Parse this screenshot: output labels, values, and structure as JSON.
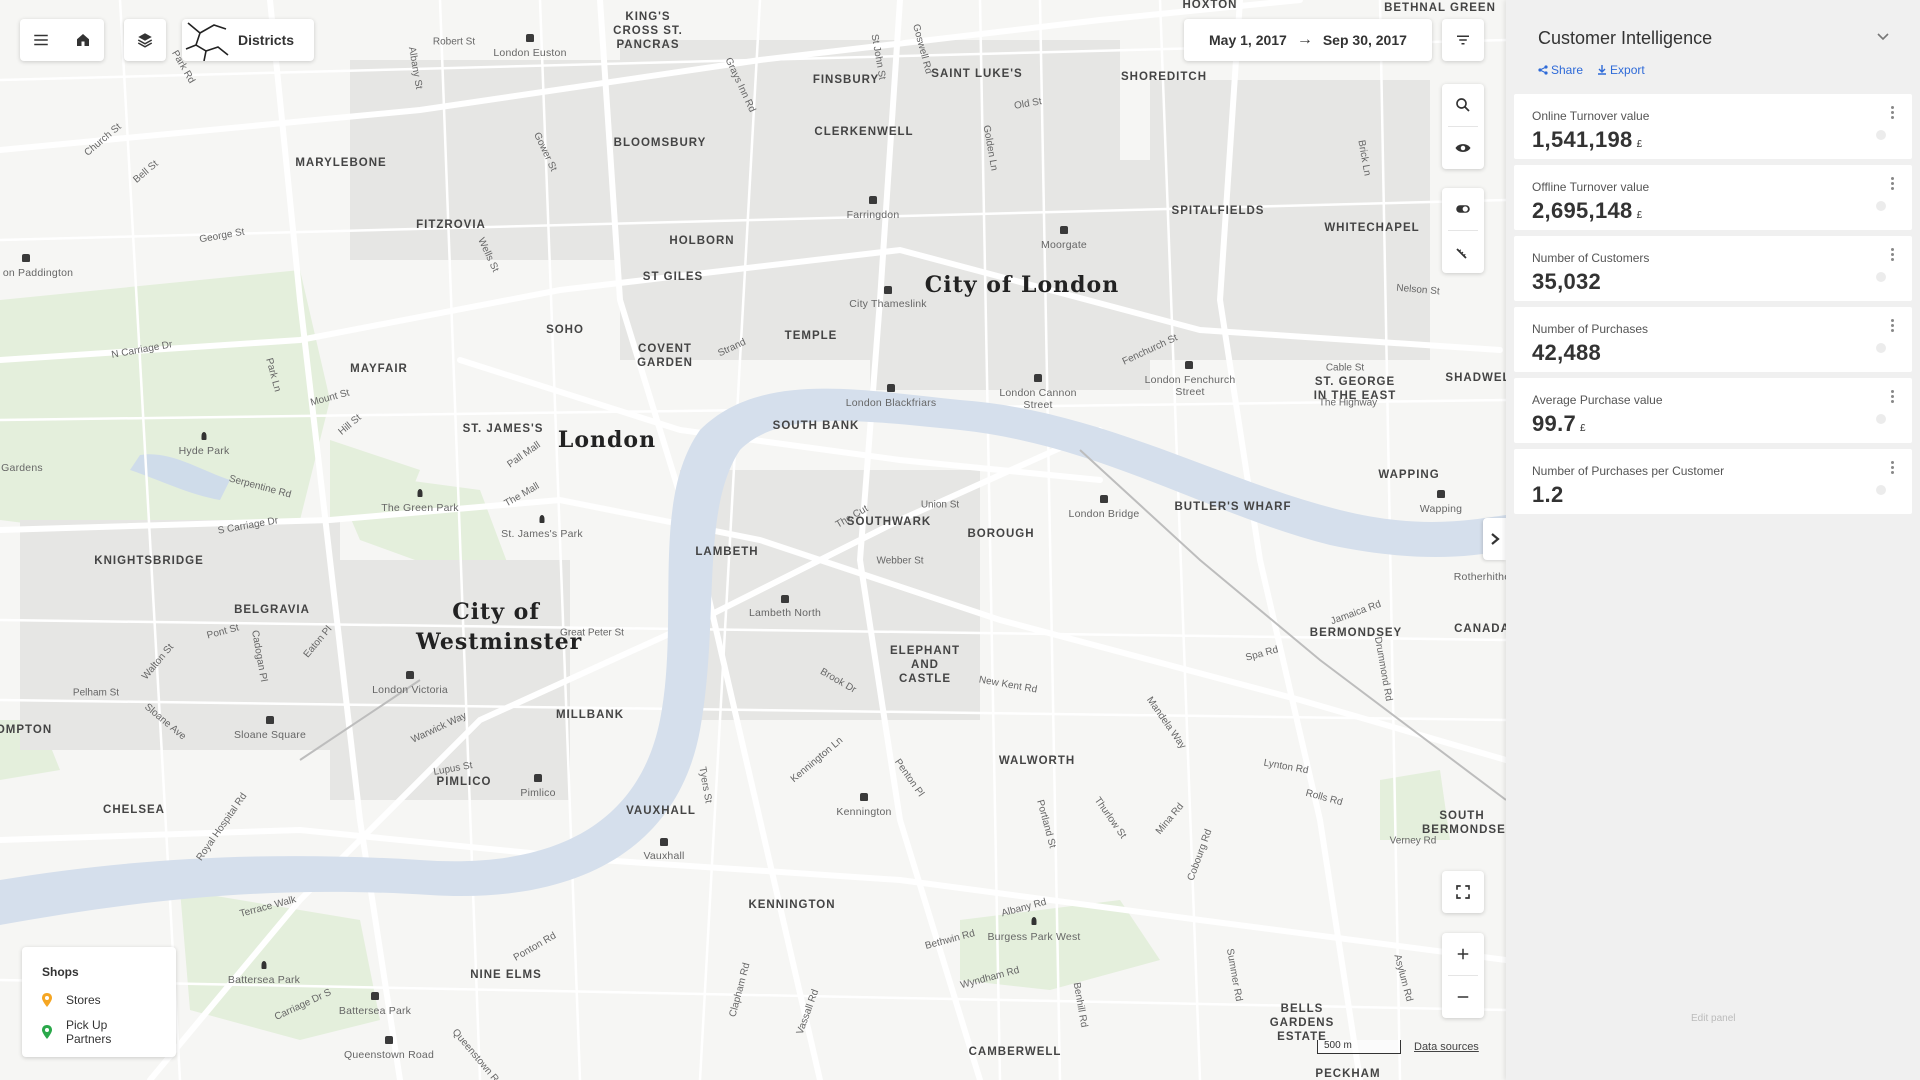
{
  "toolbar": {
    "menu_icon": "menu-icon",
    "home_icon": "home-icon",
    "layers_icon": "layers-icon",
    "layer_name": "Districts"
  },
  "date_range": {
    "start": "May 1, 2017",
    "arrow": "→",
    "end": "Sep 30, 2017"
  },
  "map": {
    "big_labels": [
      {
        "id": "city-of-london",
        "text": "City of London"
      },
      {
        "id": "london",
        "text": "London"
      },
      {
        "id": "westminster",
        "text": "City of Westminster"
      }
    ],
    "districts": [
      "KING'S CROSS ST. PANCRAS",
      "FINSBURY",
      "SAINT LUKE'S",
      "SHOREDITCH",
      "HOXTON",
      "BETHNAL GREEN",
      "MARYLEBONE",
      "BLOOMSBURY",
      "CLERKENWELL",
      "SPITALFIELDS",
      "WHITECHAPEL",
      "FITZROVIA",
      "HOLBORN",
      "ST GILES",
      "SOHO",
      "COVENT GARDEN",
      "TEMPLE",
      "MAYFAIR",
      "ST. JAMES'S",
      "SOUTH BANK",
      "ST. GEORGE IN THE EAST",
      "SHADWELL",
      "WAPPING",
      "BUTLER'S WHARF",
      "SOUTHWARK",
      "BOROUGH",
      "LAMBETH",
      "KNIGHTSBRIDGE",
      "BELGRAVIA",
      "ELEPHANT AND CASTLE",
      "BERMONDSEY",
      "CANADA",
      "MILLBANK",
      "PIMLICO",
      "WALWORTH",
      "VAUXHALL",
      "CHELSEA",
      "KENNINGTON",
      "NINE ELMS",
      "SOUTH BERMONDSEY",
      "BELLS GARDENS ESTATE",
      "CAMBERWELL",
      "PECKHAM",
      "OMPTON"
    ],
    "pois": [
      "London Euston",
      "Farringdon",
      "Moorgate",
      "City Thameslink",
      "London Blackfriars",
      "London Cannon Street",
      "London Fenchurch Street",
      "London Bridge",
      "Wapping",
      "Hyde Park",
      "The Green Park",
      "St. James's Park",
      "London Victoria",
      "Sloane Square",
      "Pimlico",
      "Vauxhall",
      "Kennington",
      "Lambeth North",
      "Burgess Park West",
      "Battersea Park",
      "Queenstown Road",
      "Rotherhithe",
      "on Paddington",
      "Gardens"
    ],
    "streets": [
      "Robert St",
      "Albany St",
      "Park Rd",
      "Church St",
      "Bell St",
      "George St",
      "N Carriage Dr",
      "Serpentine Rd",
      "S Carriage Dr",
      "Pall Mall",
      "The Mall",
      "Great Peter St",
      "Strand",
      "Fenchurch St",
      "Cable St",
      "The Highway",
      "Union St",
      "Webber St",
      "New Kent Rd",
      "Old St",
      "Golden Ln",
      "St John St",
      "Goswell Rd",
      "Grays Inn Rd",
      "Gower St",
      "Wells St",
      "Park Ln",
      "Mount St",
      "Hill St",
      "Brick Ln",
      "Nelson St",
      "Jamaica Rd",
      "Spa Rd",
      "Lynton Rd",
      "Rolls Rd",
      "Verney Rd",
      "Albany Rd",
      "Wyndham Rd",
      "Pont St",
      "Eaton Pl",
      "Cadogan Pl",
      "Walton St",
      "Pelham St",
      "Sloane Ave",
      "Lupus St",
      "Warwick Way",
      "Tyers St",
      "Kennington Ln",
      "Penton Pl",
      "Brook Dr",
      "Portland St",
      "Thurlow St",
      "Mina Rd",
      "Cobourg Rd",
      "Ponton Rd",
      "Terrace Walk",
      "Carriage Dr S",
      "Queenstown Rd",
      "Clapham Rd",
      "Vassall Rd",
      "Bethwin Rd",
      "Benhill Rd",
      "Summer Rd",
      "Asylum Rd",
      "The Cut",
      "Royal Hospital Rd",
      "Mandela Way",
      "Drummond Rd"
    ]
  },
  "legend": {
    "title": "Shops",
    "items": [
      {
        "label": "Stores",
        "color": "#f5a623"
      },
      {
        "label": "Pick Up Partners",
        "color": "#2aa84a"
      }
    ]
  },
  "scale_label": "500 m",
  "data_sources": "Data sources",
  "panel": {
    "title": "Customer Intelligence",
    "share": "Share",
    "export": "Export",
    "kpis": [
      {
        "label": "Online Turnover value",
        "value": "1,541,198",
        "unit": "£"
      },
      {
        "label": "Offline Turnover value",
        "value": "2,695,148",
        "unit": "£"
      },
      {
        "label": "Number of Customers",
        "value": "35,032",
        "unit": ""
      },
      {
        "label": "Number of Purchases",
        "value": "42,488",
        "unit": ""
      },
      {
        "label": "Average Purchase value",
        "value": "99.7",
        "unit": "£"
      },
      {
        "label": "Number of Purchases per Customer",
        "value": "1.2",
        "unit": ""
      }
    ],
    "edit_panel": "Edit panel"
  }
}
